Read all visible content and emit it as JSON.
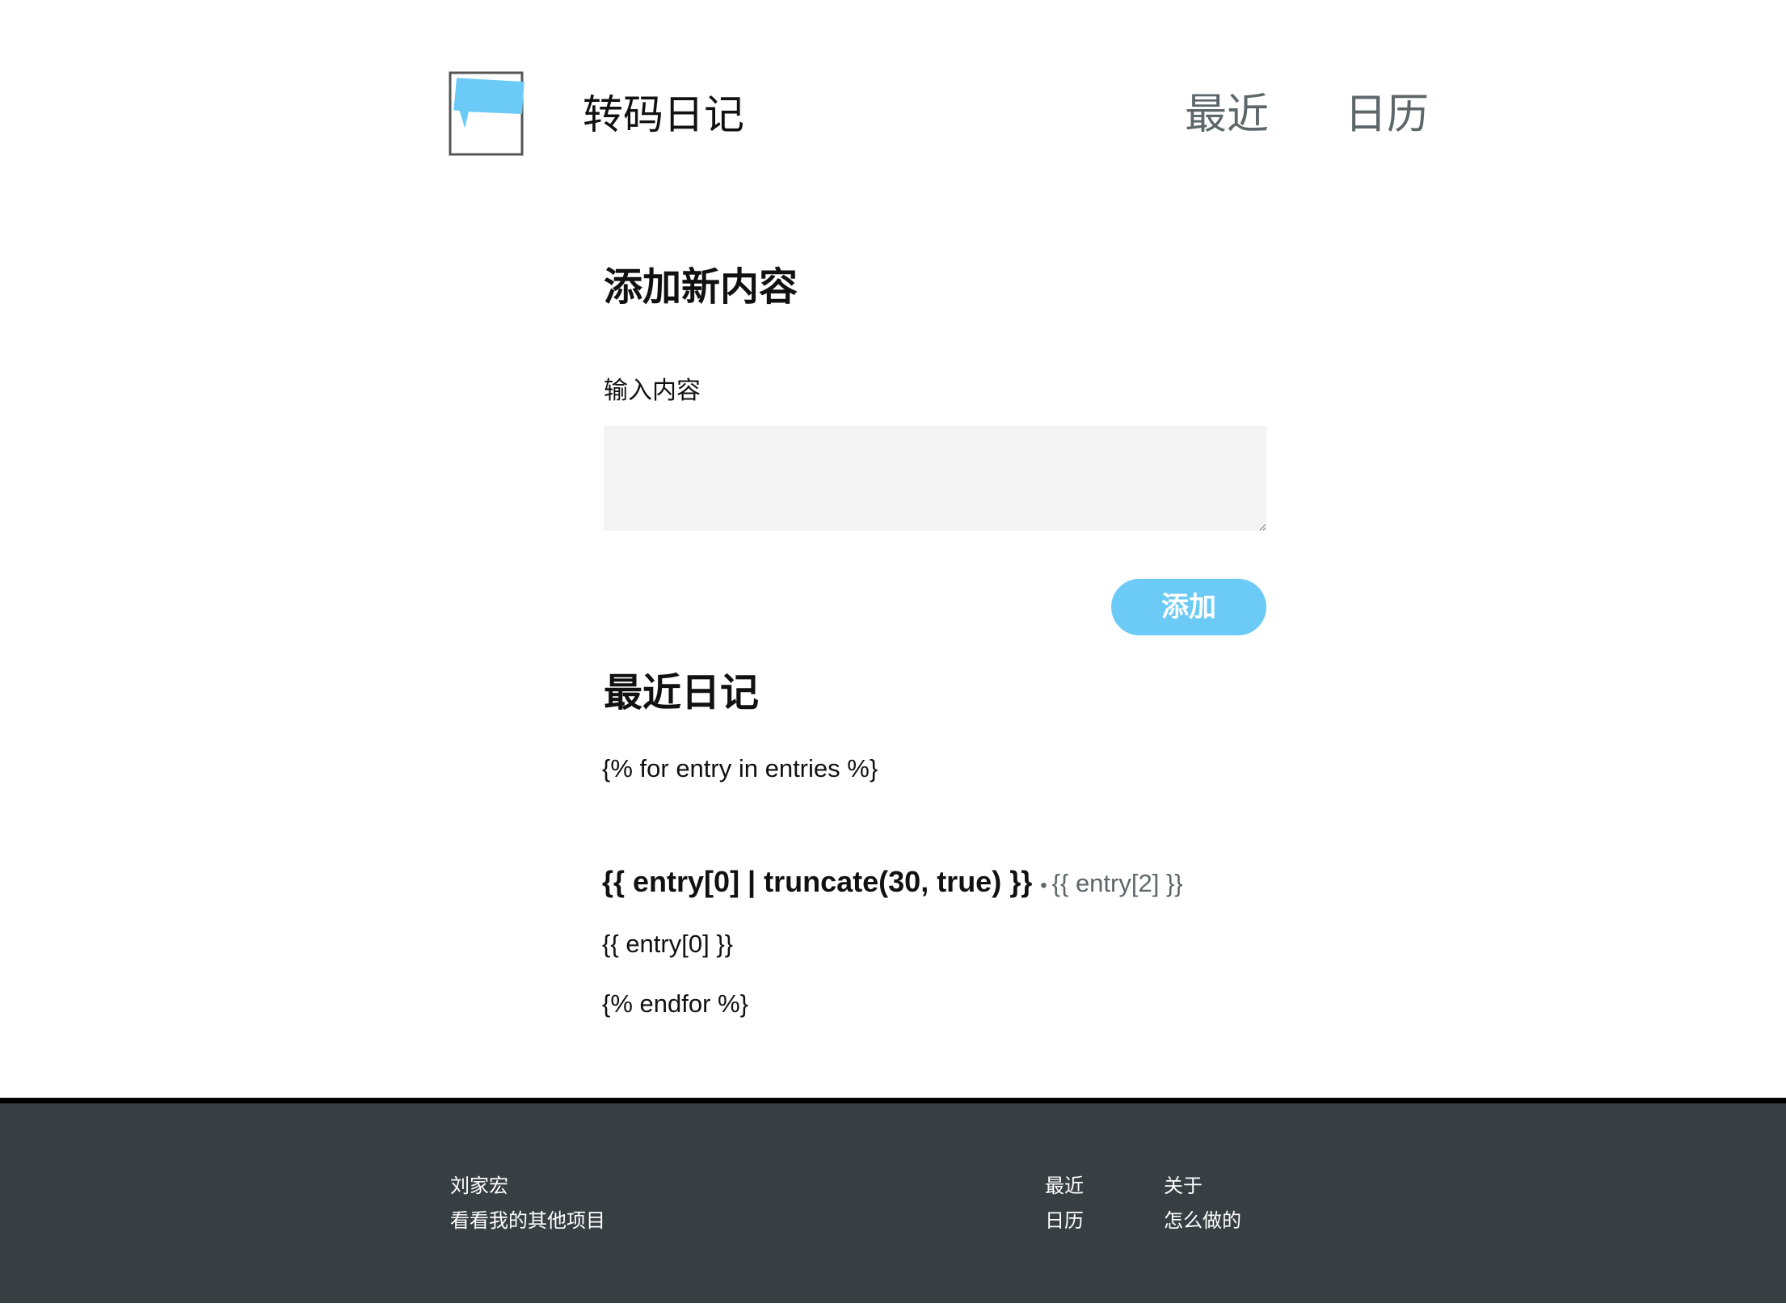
{
  "header": {
    "site_title": "转码日记",
    "logo_icon": "speech-bubble-icon",
    "nav": {
      "recent": "最近",
      "calendar": "日历"
    }
  },
  "add_section": {
    "heading": "添加新内容",
    "input_label": "输入内容",
    "textarea_value": "",
    "button_label": "添加"
  },
  "recent_section": {
    "heading": "最近日记",
    "template_for": "{% for entry in entries %}",
    "entry_title": "{{ entry[0] | truncate(30, true) }}",
    "entry_separator": "•",
    "entry_date": "{{ entry[2] }}",
    "entry_content": "{{ entry[0] }}",
    "template_endfor": "{% endfor %}"
  },
  "footer": {
    "author": "刘家宏",
    "projects_link": "看看我的其他项目",
    "recent_link": "最近",
    "calendar_link": "日历",
    "about_link": "关于",
    "how_made_link": "怎么做的"
  },
  "colors": {
    "accent": "#6ccbf6",
    "nav_text": "#5d6669",
    "textarea_bg": "#f3f4f3",
    "footer_bg": "#383f42",
    "footer_border": "#000000"
  }
}
